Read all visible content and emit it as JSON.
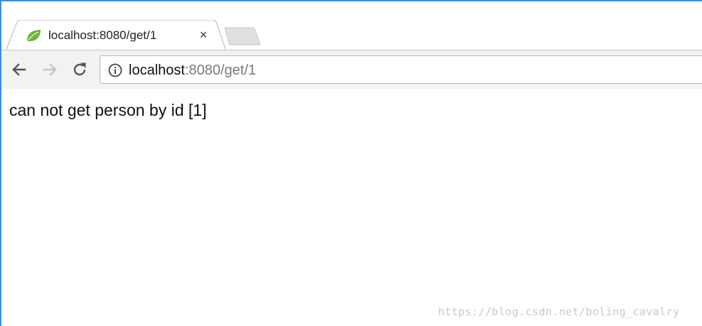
{
  "browser": {
    "tab": {
      "title": "localhost:8080/get/1",
      "close_glyph": "×",
      "favicon": "spring-leaf-icon",
      "favicon_color": "#6db33f"
    },
    "toolbar": {
      "back_icon": "arrow-left-icon",
      "forward_icon": "arrow-right-icon",
      "reload_icon": "reload-icon"
    },
    "address_bar": {
      "host": "localhost",
      "rest": ":8080/get/1",
      "security_icon": "info-icon"
    },
    "accent_color": "#3c8fd8"
  },
  "page": {
    "body_text": "can not get person by id [1]"
  },
  "watermark": {
    "text": "https://blog.csdn.net/boling_cavalry"
  }
}
